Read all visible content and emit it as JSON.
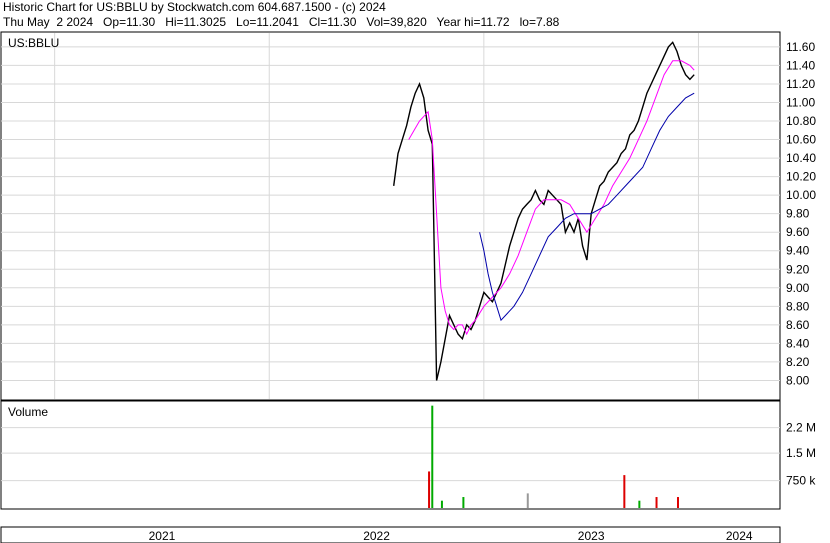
{
  "header": {
    "line1": "Historic Chart for US:BBLU by Stockwatch.com 604.687.1500 - (c) 2024",
    "line2": "Thu May  2 2024   Op=11.30   Hi=11.3025   Lo=11.2041   Cl=11.30   Vol=39,820   Year hi=11.72   lo=7.88"
  },
  "chart_data": {
    "type": "line",
    "symbol_label": "US:BBLU",
    "volume_label": "Volume",
    "price_axis": {
      "ticks": [
        "11.60",
        "11.40",
        "11.20",
        "11.00",
        "10.80",
        "10.60",
        "10.40",
        "10.20",
        "10.00",
        "9.80",
        "9.60",
        "9.40",
        "9.20",
        "9.00",
        "8.80",
        "8.60",
        "8.40",
        "8.20",
        "8.00"
      ],
      "ylim": [
        7.8,
        11.75
      ]
    },
    "volume_axis": {
      "ticks": [
        "2.2 M",
        "1.5 M",
        "750 k"
      ],
      "tick_values": [
        2200000,
        1500000,
        750000
      ],
      "ylim": [
        0,
        2900000
      ]
    },
    "year_labels": [
      "2021",
      "2022",
      "2023",
      "2024"
    ],
    "colors": {
      "price": "#000000",
      "ma_short": "#ff00ff",
      "ma_long": "#0000aa",
      "vol_up": "#00aa00",
      "vol_down": "#dd0000",
      "vol_flat": "#999999",
      "grid": "#d8d8d8"
    },
    "series": [
      {
        "key": "price",
        "values": [
          [
            2022.58,
            10.1
          ],
          [
            2022.6,
            10.45
          ],
          [
            2022.62,
            10.6
          ],
          [
            2022.64,
            10.75
          ],
          [
            2022.66,
            10.95
          ],
          [
            2022.68,
            11.1
          ],
          [
            2022.7,
            11.2
          ],
          [
            2022.72,
            11.05
          ],
          [
            2022.74,
            10.7
          ],
          [
            2022.76,
            10.55
          ],
          [
            2022.78,
            8.0
          ],
          [
            2022.8,
            8.2
          ],
          [
            2022.82,
            8.45
          ],
          [
            2022.84,
            8.7
          ],
          [
            2022.86,
            8.6
          ],
          [
            2022.88,
            8.5
          ],
          [
            2022.9,
            8.45
          ],
          [
            2022.92,
            8.6
          ],
          [
            2022.94,
            8.55
          ],
          [
            2022.96,
            8.65
          ],
          [
            2022.98,
            8.8
          ],
          [
            2023.0,
            8.95
          ],
          [
            2023.02,
            8.9
          ],
          [
            2023.04,
            8.85
          ],
          [
            2023.06,
            8.95
          ],
          [
            2023.08,
            9.05
          ],
          [
            2023.1,
            9.25
          ],
          [
            2023.12,
            9.45
          ],
          [
            2023.14,
            9.6
          ],
          [
            2023.16,
            9.75
          ],
          [
            2023.18,
            9.85
          ],
          [
            2023.2,
            9.9
          ],
          [
            2023.22,
            9.95
          ],
          [
            2023.24,
            10.05
          ],
          [
            2023.26,
            9.95
          ],
          [
            2023.28,
            9.9
          ],
          [
            2023.3,
            10.05
          ],
          [
            2023.32,
            10.0
          ],
          [
            2023.34,
            9.95
          ],
          [
            2023.36,
            9.9
          ],
          [
            2023.38,
            9.6
          ],
          [
            2023.4,
            9.7
          ],
          [
            2023.42,
            9.6
          ],
          [
            2023.44,
            9.75
          ],
          [
            2023.46,
            9.45
          ],
          [
            2023.48,
            9.3
          ],
          [
            2023.5,
            9.8
          ],
          [
            2023.52,
            9.95
          ],
          [
            2023.54,
            10.1
          ],
          [
            2023.56,
            10.15
          ],
          [
            2023.58,
            10.25
          ],
          [
            2023.6,
            10.3
          ],
          [
            2023.62,
            10.35
          ],
          [
            2023.64,
            10.45
          ],
          [
            2023.66,
            10.5
          ],
          [
            2023.68,
            10.65
          ],
          [
            2023.7,
            10.7
          ],
          [
            2023.72,
            10.8
          ],
          [
            2023.74,
            10.95
          ],
          [
            2023.76,
            11.1
          ],
          [
            2023.78,
            11.2
          ],
          [
            2023.8,
            11.3
          ],
          [
            2023.82,
            11.4
          ],
          [
            2023.84,
            11.5
          ],
          [
            2023.86,
            11.6
          ],
          [
            2023.88,
            11.65
          ],
          [
            2023.9,
            11.55
          ],
          [
            2023.92,
            11.4
          ],
          [
            2023.94,
            11.3
          ],
          [
            2023.96,
            11.25
          ],
          [
            2023.98,
            11.3
          ]
        ]
      },
      {
        "key": "ma_short",
        "values": [
          [
            2022.65,
            10.6
          ],
          [
            2022.7,
            10.8
          ],
          [
            2022.74,
            10.9
          ],
          [
            2022.76,
            10.6
          ],
          [
            2022.78,
            9.8
          ],
          [
            2022.8,
            9.0
          ],
          [
            2022.82,
            8.75
          ],
          [
            2022.84,
            8.6
          ],
          [
            2022.86,
            8.55
          ],
          [
            2022.88,
            8.6
          ],
          [
            2022.9,
            8.6
          ],
          [
            2022.92,
            8.5
          ],
          [
            2022.94,
            8.6
          ],
          [
            2022.96,
            8.65
          ],
          [
            2023.0,
            8.8
          ],
          [
            2023.04,
            8.9
          ],
          [
            2023.08,
            9.0
          ],
          [
            2023.12,
            9.15
          ],
          [
            2023.16,
            9.35
          ],
          [
            2023.2,
            9.6
          ],
          [
            2023.24,
            9.85
          ],
          [
            2023.28,
            9.95
          ],
          [
            2023.32,
            9.95
          ],
          [
            2023.36,
            9.95
          ],
          [
            2023.4,
            9.9
          ],
          [
            2023.44,
            9.75
          ],
          [
            2023.48,
            9.6
          ],
          [
            2023.52,
            9.75
          ],
          [
            2023.56,
            9.9
          ],
          [
            2023.6,
            10.1
          ],
          [
            2023.64,
            10.25
          ],
          [
            2023.68,
            10.4
          ],
          [
            2023.72,
            10.6
          ],
          [
            2023.76,
            10.8
          ],
          [
            2023.8,
            11.05
          ],
          [
            2023.84,
            11.3
          ],
          [
            2023.88,
            11.45
          ],
          [
            2023.92,
            11.45
          ],
          [
            2023.96,
            11.4
          ],
          [
            2023.98,
            11.35
          ]
        ]
      },
      {
        "key": "ma_long",
        "values": [
          [
            2022.98,
            9.6
          ],
          [
            2023.0,
            9.4
          ],
          [
            2023.02,
            9.15
          ],
          [
            2023.04,
            8.95
          ],
          [
            2023.06,
            8.8
          ],
          [
            2023.08,
            8.65
          ],
          [
            2023.1,
            8.7
          ],
          [
            2023.14,
            8.8
          ],
          [
            2023.18,
            8.95
          ],
          [
            2023.22,
            9.15
          ],
          [
            2023.26,
            9.35
          ],
          [
            2023.3,
            9.55
          ],
          [
            2023.34,
            9.65
          ],
          [
            2023.38,
            9.75
          ],
          [
            2023.42,
            9.8
          ],
          [
            2023.46,
            9.8
          ],
          [
            2023.5,
            9.8
          ],
          [
            2023.54,
            9.85
          ],
          [
            2023.58,
            9.9
          ],
          [
            2023.62,
            10.0
          ],
          [
            2023.66,
            10.1
          ],
          [
            2023.7,
            10.2
          ],
          [
            2023.74,
            10.3
          ],
          [
            2023.78,
            10.5
          ],
          [
            2023.82,
            10.7
          ],
          [
            2023.86,
            10.85
          ],
          [
            2023.9,
            10.95
          ],
          [
            2023.94,
            11.05
          ],
          [
            2023.98,
            11.1
          ]
        ]
      }
    ],
    "volume": [
      [
        2022.74,
        1000000,
        "down"
      ],
      [
        2022.755,
        2800000,
        "up"
      ],
      [
        2022.8,
        200000,
        "up"
      ],
      [
        2022.9,
        300000,
        "up"
      ],
      [
        2023.2,
        400000,
        "flat"
      ],
      [
        2023.65,
        900000,
        "down"
      ],
      [
        2023.72,
        200000,
        "up"
      ],
      [
        2023.8,
        300000,
        "down"
      ],
      [
        2023.9,
        300000,
        "down"
      ]
    ]
  }
}
